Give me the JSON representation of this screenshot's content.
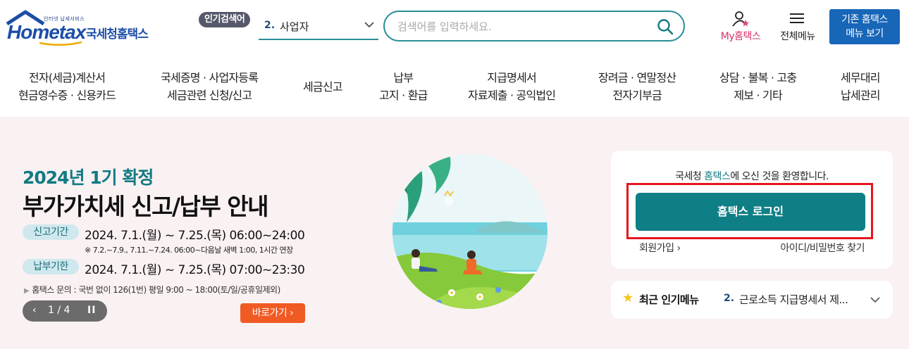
{
  "header": {
    "logo": {
      "tagline": "인터넷 납세서비스",
      "brand": "Hometax",
      "name_kr": "국세청홈택스"
    },
    "popular_search": {
      "badge": "인기검색어",
      "rank": "2.",
      "keyword": "사업자"
    },
    "search": {
      "placeholder": "검색어를 입력하세요."
    },
    "my_hometax": "My홈택스",
    "all_menu": "전체메뉴",
    "old_hometax": [
      "기존 홈택스",
      "메뉴 보기"
    ]
  },
  "nav": [
    [
      "전자(세금)계산서",
      "현금영수증 · 신용카드"
    ],
    [
      "국세증명 · 사업자등록",
      "세금관련 신청/신고"
    ],
    [
      "세금신고"
    ],
    [
      "납부",
      "고지 · 환급"
    ],
    [
      "지급명세서",
      "자료제출 · 공익법인"
    ],
    [
      "장려금 · 연말정산",
      "전자기부금"
    ],
    [
      "상담 · 불복 · 고충",
      "제보 · 기타"
    ],
    [
      "세무대리",
      "납세관리"
    ]
  ],
  "banner": {
    "subtitle": "2024년 1기 확정",
    "title": "부가가치세 신고/납부 안내",
    "report_label": "신고기간",
    "report_period": "2024. 7.1.(월) ~ 7.25.(목) 06:00~24:00",
    "note": "※ 7.2.~7.9., 7.11.~7.24. 06:00~다음날 새벽 1:00, 1시간 연장",
    "pay_label": "납부기한",
    "pay_period": "2024. 7.1.(월) ~ 7.25.(목) 07:00~23:30",
    "inquiry": "홈택스 문의 : 국번 없이 126(1번) 평일 9:00 ~ 18:00(토/일/공휴일제외)",
    "slide_counter": "1 / 4",
    "go_button": "바로가기"
  },
  "login": {
    "welcome_prefix": "국세청 ",
    "welcome_highlight": "홈택스",
    "welcome_suffix": "에 오신 것을 환영합니다.",
    "login_button": "홈택스 로그인",
    "join": "회원가입",
    "find": "아이디/비밀번호 찾기"
  },
  "popular_menu": {
    "title": "최근 인기메뉴",
    "rank": "2.",
    "item": "근로소득 지급명세서 제..."
  },
  "colors": {
    "brand_teal": "#0f7f86",
    "brand_blue": "#1866b8",
    "accent_orange": "#f05a23",
    "highlight_red": "#e6141e"
  }
}
